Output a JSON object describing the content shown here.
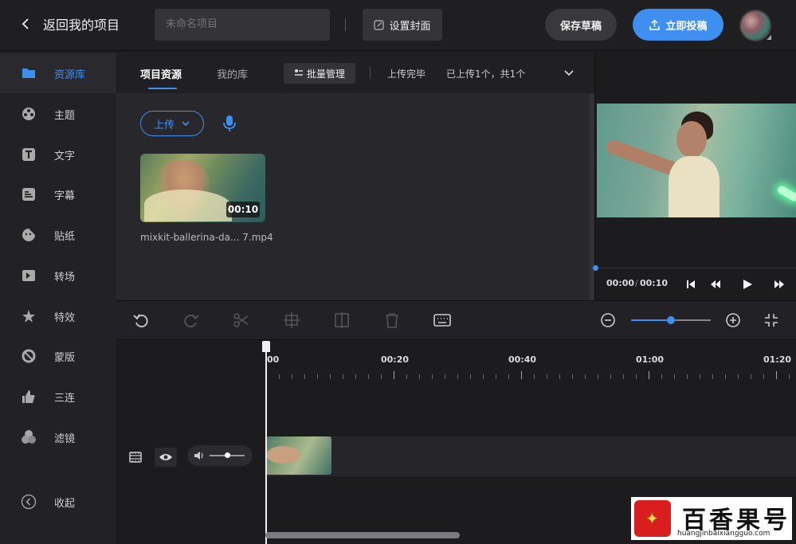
{
  "header": {
    "back_label": "返回我的项目",
    "project_name_placeholder": "未命名项目",
    "cover_label": "设置封面",
    "save_draft_label": "保存草稿",
    "submit_label": "立即投稿"
  },
  "sidebar": {
    "items": [
      {
        "label": "资源库",
        "icon": "folder-icon"
      },
      {
        "label": "主题",
        "icon": "film-reel-icon"
      },
      {
        "label": "文字",
        "icon": "text-icon"
      },
      {
        "label": "字幕",
        "icon": "subtitle-icon"
      },
      {
        "label": "贴纸",
        "icon": "sticker-icon"
      },
      {
        "label": "转场",
        "icon": "transition-icon"
      },
      {
        "label": "特效",
        "icon": "effects-icon"
      },
      {
        "label": "蒙版",
        "icon": "mask-icon"
      },
      {
        "label": "三连",
        "icon": "thumbs-up-icon"
      },
      {
        "label": "滤镜",
        "icon": "filter-icon"
      }
    ],
    "collapse_label": "收起"
  },
  "resources": {
    "tabs": [
      "项目资源",
      "我的库"
    ],
    "batch_label": "批量管理",
    "upload_status": "上传完毕",
    "upload_count": "已上传1个，共1个",
    "upload_button": "上传",
    "media": [
      {
        "filename": "mixkit-ballerina-da... 7.mp4",
        "duration": "00:10"
      }
    ]
  },
  "preview": {
    "current_time": "00:00",
    "separator": "/",
    "total_time": "00:10"
  },
  "timeline": {
    "ruler_labels": [
      "00",
      "00:20",
      "00:40",
      "01:00",
      "01:20"
    ],
    "zoom_level": 0.5,
    "volume_level": 0.5
  },
  "watermark": {
    "title": "百香果号",
    "url": "huangjinbaixiangguo.com"
  },
  "colors": {
    "accent": "#3f8ff0",
    "background": "#1b1b1e",
    "panel": "#28282c"
  }
}
